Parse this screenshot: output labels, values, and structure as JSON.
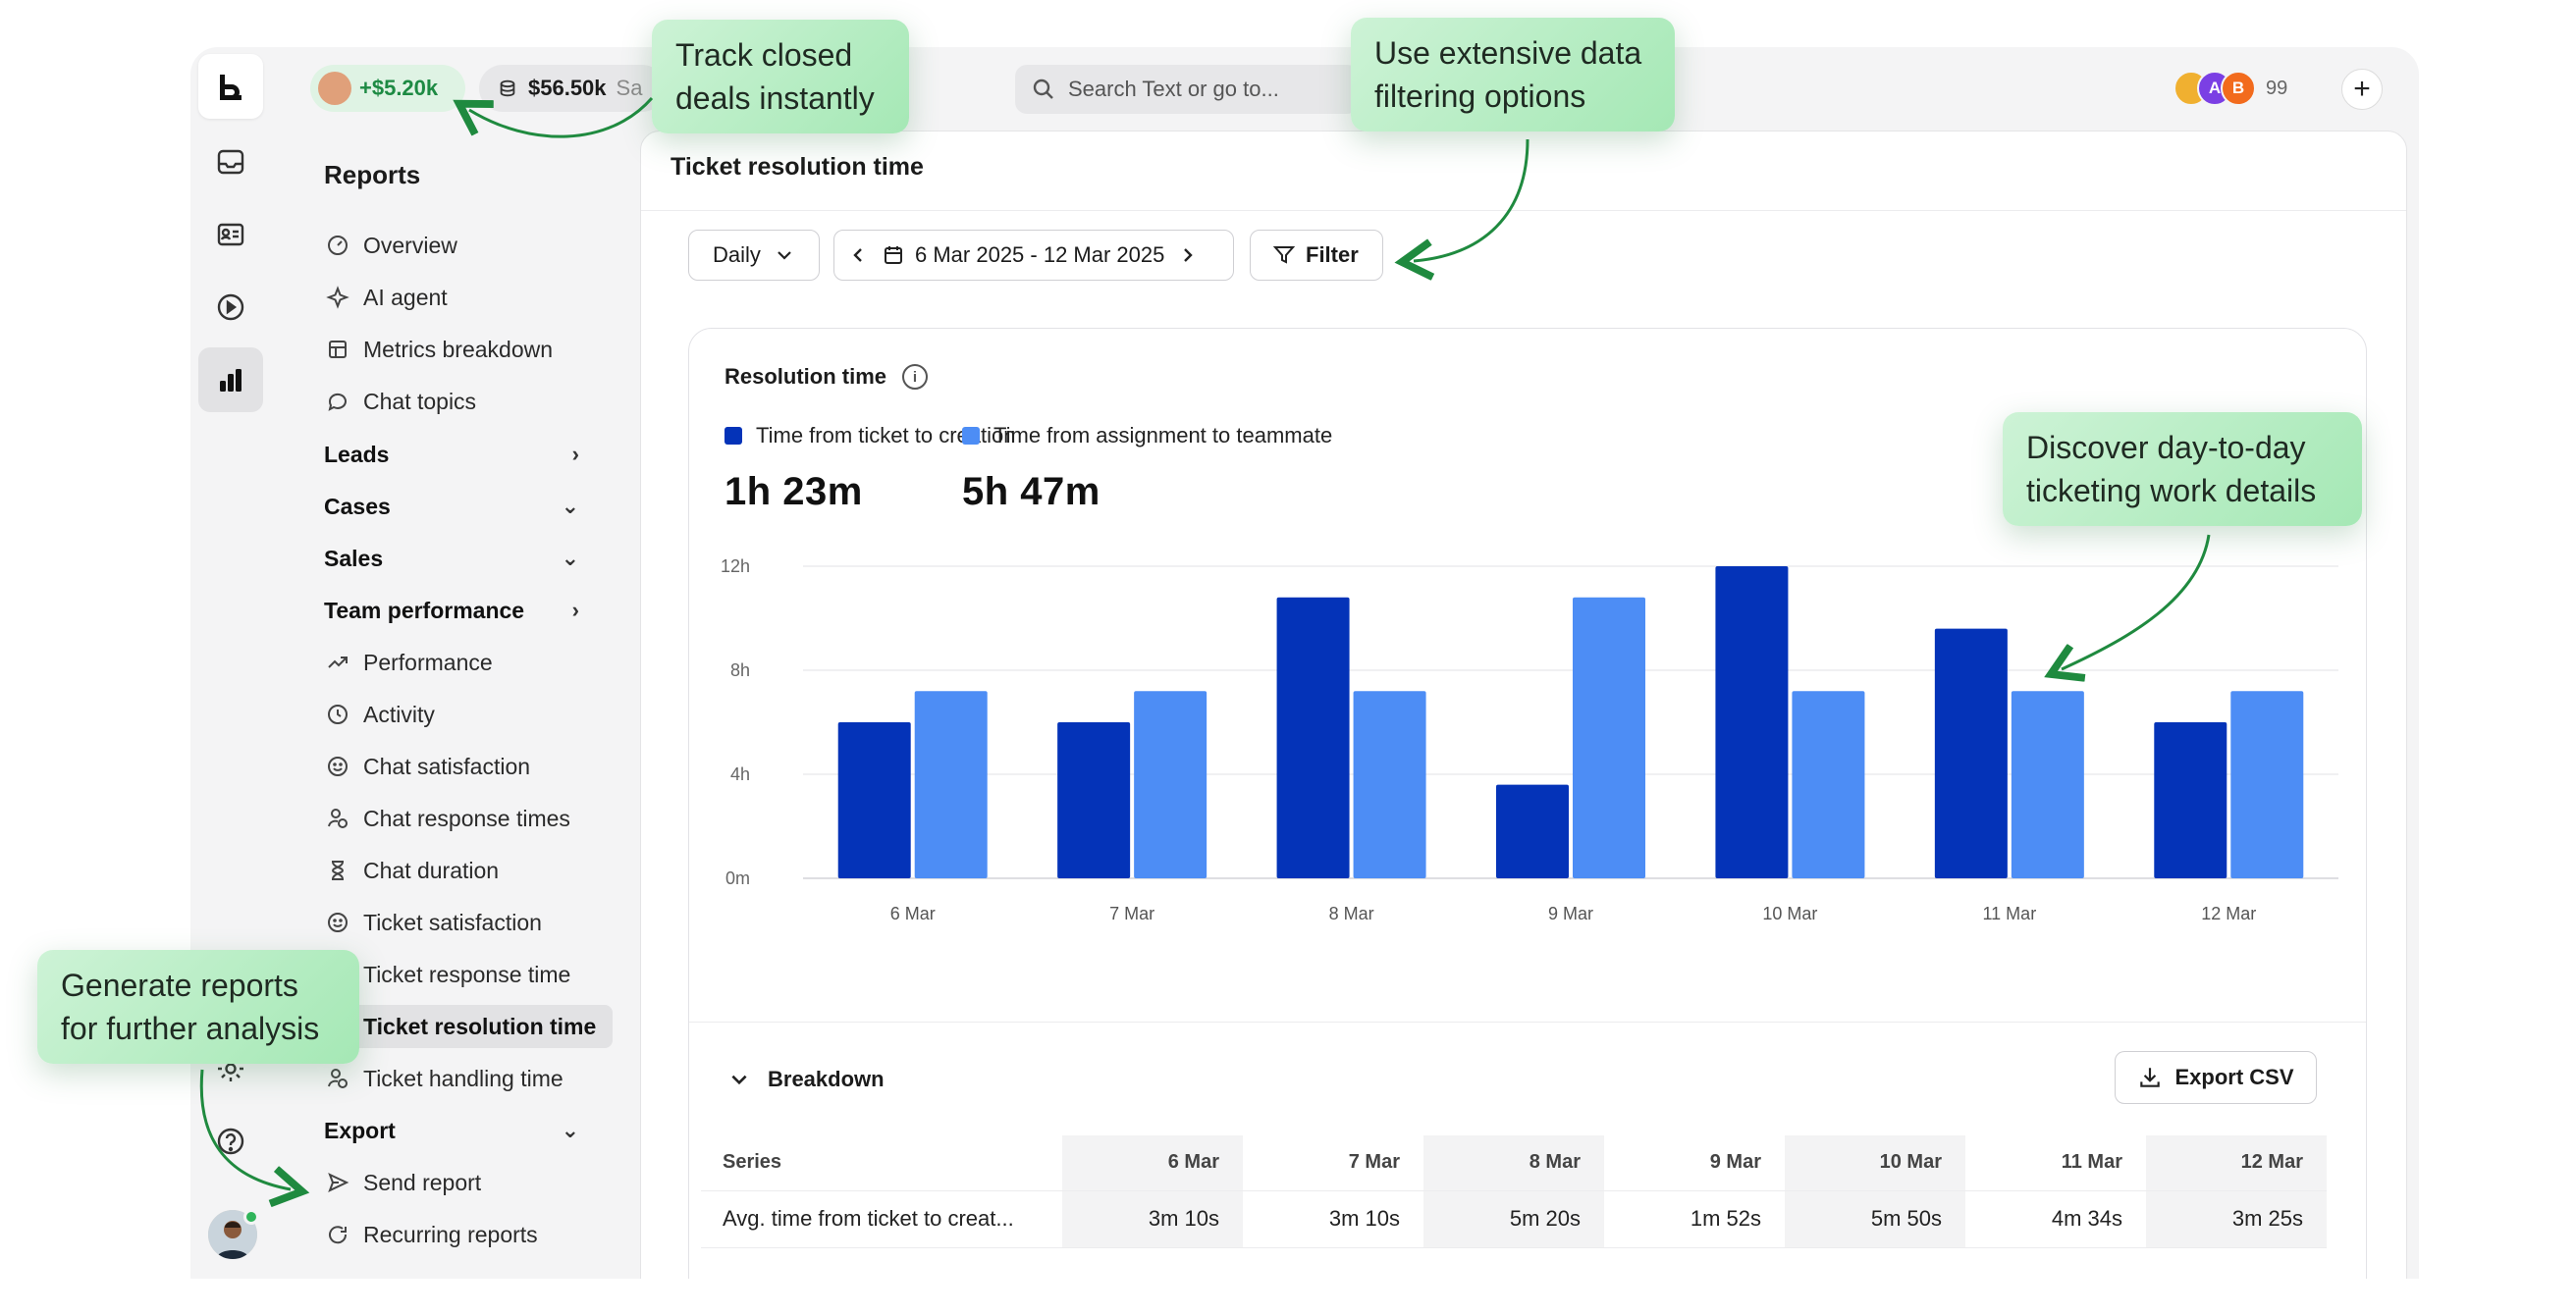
{
  "topbar": {
    "won_amount": "+$5.20k",
    "pipeline_amount": "$56.50k",
    "pipeline_suffix": "Sa",
    "search_placeholder": "Search Text or go to...",
    "team_initials": [
      "",
      "A",
      "B"
    ],
    "team_count": "99",
    "plus_label": "+"
  },
  "sidebar": {
    "title": "Reports",
    "items": [
      {
        "label": "Overview",
        "icon": "gauge-icon"
      },
      {
        "label": "AI agent",
        "icon": "sparkle-icon"
      },
      {
        "label": "Metrics breakdown",
        "icon": "table-icon"
      },
      {
        "label": "Chat topics",
        "icon": "chat-bubble-icon"
      }
    ],
    "sections": {
      "leads": "Leads",
      "cases": "Cases",
      "sales": "Sales",
      "team_performance": "Team performance",
      "export": "Export"
    },
    "team_items": [
      {
        "label": "Performance",
        "icon": "trend-up-icon"
      },
      {
        "label": "Activity",
        "icon": "clock-icon"
      },
      {
        "label": "Chat satisfaction",
        "icon": "smiley-icon"
      },
      {
        "label": "Chat response times",
        "icon": "person-clock-icon"
      },
      {
        "label": "Chat duration",
        "icon": "hourglass-icon"
      },
      {
        "label": "Ticket satisfaction",
        "icon": "smiley-icon"
      },
      {
        "label": "Ticket response time",
        "icon": "clock-icon"
      },
      {
        "label": "Ticket resolution time",
        "icon": "check-clock-icon"
      },
      {
        "label": "Ticket handling time",
        "icon": "person-clock-icon"
      }
    ],
    "export_items": [
      {
        "label": "Send report",
        "icon": "send-icon"
      },
      {
        "label": "Recurring reports",
        "icon": "refresh-icon"
      }
    ]
  },
  "main": {
    "title": "Ticket resolution time",
    "granularity": "Daily",
    "date_range": "6 Mar 2025 - 12 Mar 2025",
    "filter_label": "Filter"
  },
  "card": {
    "title": "Resolution time",
    "series": [
      {
        "name": "Time from ticket to creation",
        "total": "1h 23m",
        "color": "#0433b8"
      },
      {
        "name": "Time from assignment to teammate",
        "total": "5h 47m",
        "color": "#4d8df5"
      }
    ]
  },
  "chart_data": {
    "type": "bar",
    "title": "Resolution time",
    "categories": [
      "6 Mar",
      "7 Mar",
      "8 Mar",
      "9 Mar",
      "10 Mar",
      "11 Mar",
      "12 Mar"
    ],
    "y_ticks": [
      "0m",
      "4h",
      "8h",
      "12h"
    ],
    "ylim": [
      0,
      12
    ],
    "series": [
      {
        "name": "Time from ticket to creation",
        "values": [
          6,
          6,
          10.8,
          3.6,
          12,
          9.6,
          6
        ]
      },
      {
        "name": "Time from assignment to teammate",
        "values": [
          7.2,
          7.2,
          7.2,
          10.8,
          7.2,
          7.2,
          7.2
        ]
      }
    ],
    "grid": true
  },
  "breakdown": {
    "title": "Breakdown",
    "export_label": "Export CSV",
    "series_header": "Series",
    "columns": [
      "6 Mar",
      "7 Mar",
      "8 Mar",
      "9 Mar",
      "10 Mar",
      "11 Mar",
      "12 Mar"
    ],
    "rows": [
      {
        "series": "Avg. time from ticket to creat...",
        "values": [
          "3m 10s",
          "3m 10s",
          "5m 20s",
          "1m 52s",
          "5m 50s",
          "4m 34s",
          "3m 25s"
        ]
      }
    ]
  },
  "callouts": {
    "track": "Track closed deals instantly",
    "filter": "Use extensive data filtering options",
    "discover": "Discover day-to-day ticketing work details",
    "generate": "Generate reports for further analysis"
  },
  "colors": {
    "accent_dark": "#0433b8",
    "accent_light": "#4d8df5",
    "callout_green": "#a5e8b5",
    "arrow_green": "#1f8a3f"
  }
}
